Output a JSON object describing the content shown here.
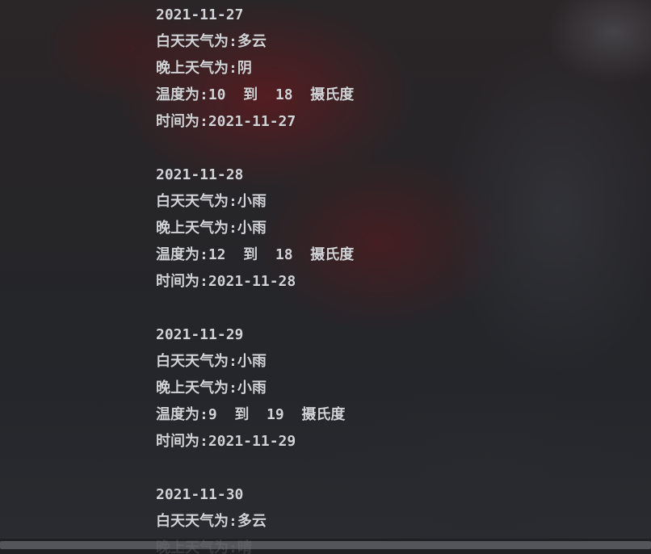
{
  "console": {
    "lines": [
      "2021-11-27",
      "白天天气为:多云",
      "晚上天气为:阴",
      "温度为:10  到  18  摄氏度",
      "时间为:2021-11-27",
      "",
      "2021-11-28",
      "白天天气为:小雨",
      "晚上天气为:小雨",
      "温度为:12  到  18  摄氏度",
      "时间为:2021-11-28",
      "",
      "2021-11-29",
      "白天天气为:小雨",
      "晚上天气为:小雨",
      "温度为:9  到  19  摄氏度",
      "时间为:2021-11-29",
      "",
      "2021-11-30",
      "白天天气为:多云",
      "晚上天气为:晴"
    ]
  }
}
